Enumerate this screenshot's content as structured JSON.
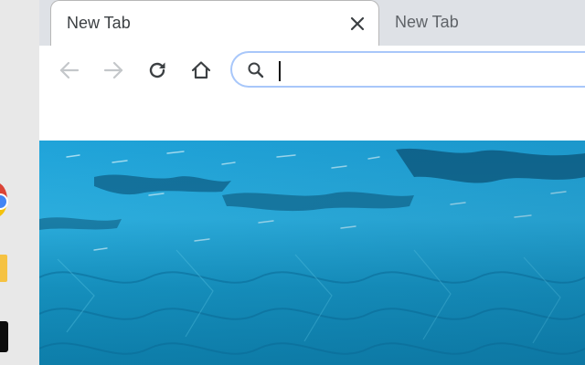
{
  "colors": {
    "tab_strip": "#dee1e6",
    "omnibox_border": "#a8c7fa",
    "ocean_deep": "#0a6fa3",
    "ocean_light": "#36b6e0"
  },
  "tabs": [
    {
      "title": "New Tab",
      "active": true,
      "close_icon": "close-icon"
    },
    {
      "title": "New Tab",
      "active": false
    }
  ],
  "toolbar": {
    "back_icon": "arrow-left-icon",
    "forward_icon": "arrow-right-icon",
    "reload_icon": "reload-icon",
    "home_icon": "home-icon"
  },
  "omnibox": {
    "icon": "search-icon",
    "value": "",
    "focused": true
  },
  "desktop_dock": {
    "icons": [
      "chrome-icon",
      "folder-icon",
      "terminal-icon"
    ]
  },
  "page": {
    "background_image": "ocean-water"
  }
}
